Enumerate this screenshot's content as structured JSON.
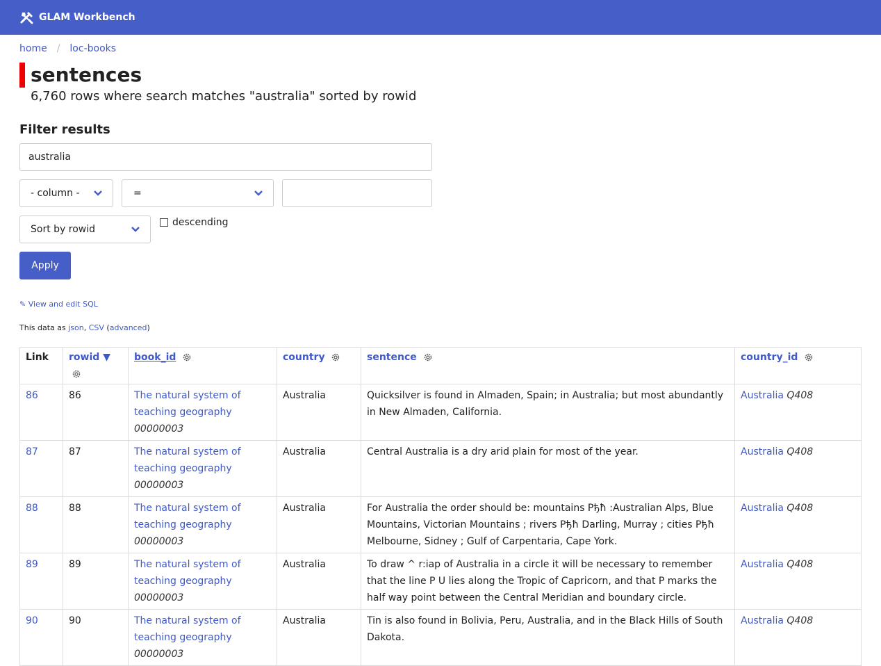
{
  "header": {
    "app_title": "GLAM Workbench"
  },
  "breadcrumb": [
    {
      "label": "home"
    },
    {
      "label": "loc-books"
    }
  ],
  "page": {
    "title": "sentences",
    "subtitle": "6,760 rows where search matches \"australia\" sorted by rowid"
  },
  "filter": {
    "heading": "Filter results",
    "search_value": "australia",
    "column_select": "- column -",
    "op_select": "=",
    "value_input": "",
    "sort_select": "Sort by rowid",
    "descending_label": "descending",
    "apply_label": "Apply"
  },
  "links": {
    "view_sql": "✎ View and edit SQL",
    "data_as": "This data as",
    "json": "json",
    "csv": "CSV",
    "advanced": "advanced"
  },
  "table": {
    "columns": [
      "Link",
      "rowid ▼",
      "book_id",
      "country",
      "sentence",
      "country_id"
    ],
    "rows": [
      {
        "link": "86",
        "rowid": "86",
        "book_title": "The natural system of teaching geography",
        "book_id": "00000003",
        "country": "Australia",
        "sentence": "Quicksilver is found in Almaden, Spain; in Australia; but most abundantly in New Almaden, California.",
        "country_label": "Australia",
        "country_id": "Q408"
      },
      {
        "link": "87",
        "rowid": "87",
        "book_title": "The natural system of teaching geography",
        "book_id": "00000003",
        "country": "Australia",
        "sentence": "Central Australia is a dry arid plain for most of the year.",
        "country_label": "Australia",
        "country_id": "Q408"
      },
      {
        "link": "88",
        "rowid": "88",
        "book_title": "The natural system of teaching geography",
        "book_id": "00000003",
        "country": "Australia",
        "sentence": "For Australia the order should be: mountains Pђħ :Australian Alps, Blue Mountains, Victorian Mountains ; rivers Pђħ Darling, Murray ; cities Pђħ Melbourne, Sidney ; Gulf of Carpentaria, Cape York.",
        "country_label": "Australia",
        "country_id": "Q408"
      },
      {
        "link": "89",
        "rowid": "89",
        "book_title": "The natural system of teaching geography",
        "book_id": "00000003",
        "country": "Australia",
        "sentence": "To draw ^ r:iap of Australia in a circle it will be necessary to remember that the line P U lies along the Tropic of Capricorn, and that P marks the half way point between the Central Meridian and boundary circle.",
        "country_label": "Australia",
        "country_id": "Q408"
      },
      {
        "link": "90",
        "rowid": "90",
        "book_title": "The natural system of teaching geography",
        "book_id": "00000003",
        "country": "Australia",
        "sentence": "Tin is also found in Bolivia, Peru, Australia, and in the Black Hills of South Dakota.",
        "country_label": "Australia",
        "country_id": "Q408"
      }
    ]
  }
}
